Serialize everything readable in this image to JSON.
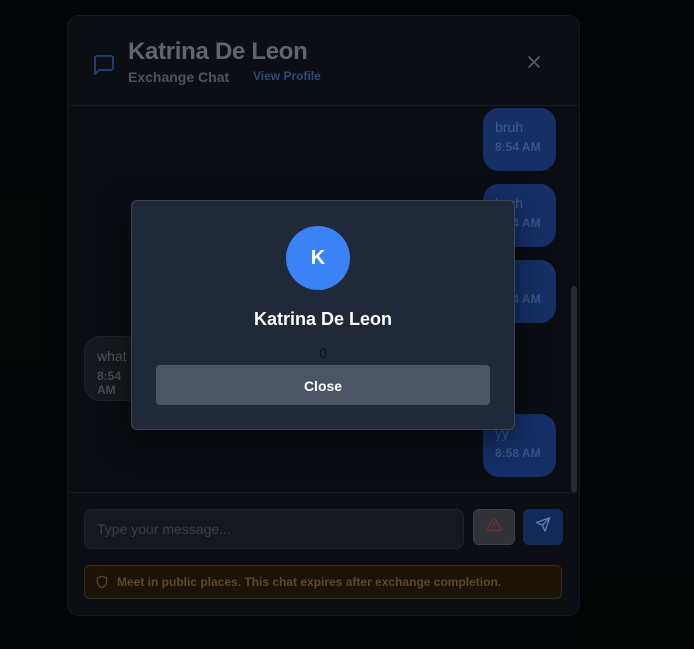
{
  "header": {
    "name": "Katrina De Leon",
    "subtitle": "Exchange Chat",
    "profile_link": "View Profile"
  },
  "messages": [
    {
      "sender": "me",
      "text": "bruh",
      "time": "8:54 AM"
    },
    {
      "sender": "me",
      "text": "bruh",
      "time": "8:54 AM"
    },
    {
      "sender": "me",
      "text": "d",
      "time": "8:54 AM"
    },
    {
      "sender": "them",
      "text": "what",
      "time": "8:54 AM"
    },
    {
      "sender": "me",
      "text": "yy",
      "time": "8:58 AM"
    }
  ],
  "composer": {
    "placeholder": "Type your message..."
  },
  "safety_note": "Meet in public places. This chat expires after exchange completion.",
  "profile_modal": {
    "avatar_initial": "K",
    "name": "Katrina De Leon",
    "count": "0",
    "close_label": "Close"
  },
  "colors": {
    "accent": "#3b82f6",
    "modal_bg": "#1f2937",
    "close_button": "#4b5563"
  },
  "icons": [
    "chat-bubble-icon",
    "close-icon",
    "warning-icon",
    "send-icon",
    "shield-icon"
  ]
}
